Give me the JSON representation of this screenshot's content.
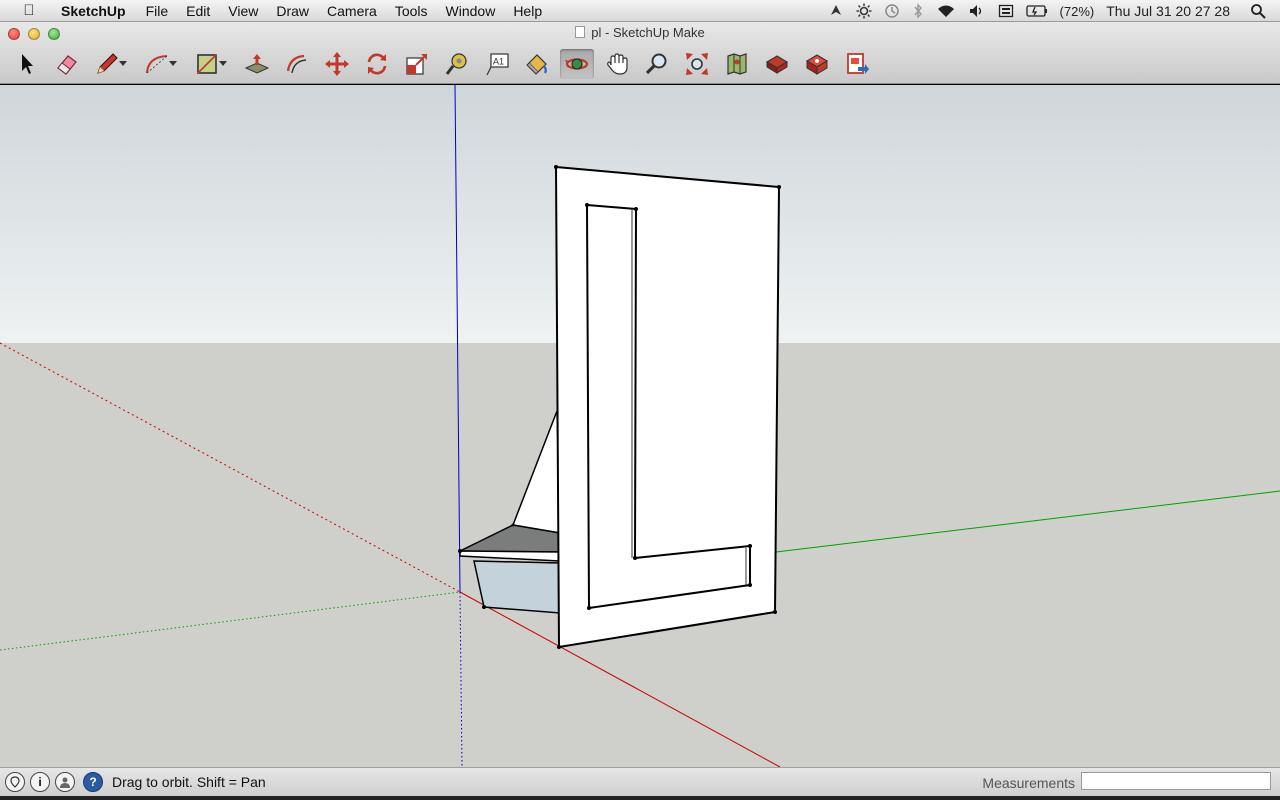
{
  "menubar": {
    "app_name": "SketchUp",
    "items": [
      "File",
      "Edit",
      "View",
      "Draw",
      "Camera",
      "Tools",
      "Window",
      "Help"
    ],
    "battery": "(72%)",
    "clock": "Thu Jul 31  20 27 28"
  },
  "window": {
    "title": "pl - SketchUp Make"
  },
  "toolbar": {
    "tools": [
      {
        "name": "select-tool",
        "icon": "arrow-cursor-icon"
      },
      {
        "name": "eraser-tool",
        "icon": "eraser-icon"
      },
      {
        "name": "line-tool",
        "icon": "pencil-icon"
      },
      {
        "name": "arc-tool",
        "icon": "arc-icon"
      },
      {
        "name": "rectangle-tool",
        "icon": "rectangle-icon"
      },
      {
        "name": "push-pull-tool",
        "icon": "push-pull-icon"
      },
      {
        "name": "offset-tool",
        "icon": "offset-icon"
      },
      {
        "name": "move-tool",
        "icon": "move-arrows-icon"
      },
      {
        "name": "rotate-tool",
        "icon": "rotate-icon"
      },
      {
        "name": "scale-tool",
        "icon": "scale-icon"
      },
      {
        "name": "tape-measure-tool",
        "icon": "tape-measure-icon"
      },
      {
        "name": "text-tool",
        "icon": "text-label-icon"
      },
      {
        "name": "paint-bucket-tool",
        "icon": "paint-bucket-icon"
      },
      {
        "name": "orbit-tool",
        "icon": "orbit-icon",
        "active": true
      },
      {
        "name": "pan-tool",
        "icon": "hand-icon"
      },
      {
        "name": "zoom-tool",
        "icon": "magnifier-icon"
      },
      {
        "name": "zoom-extents-tool",
        "icon": "zoom-extents-icon"
      },
      {
        "name": "previous-view-tool",
        "icon": "map-icon"
      },
      {
        "name": "warehouse-tool",
        "icon": "warehouse-icon"
      },
      {
        "name": "extension-warehouse-tool",
        "icon": "extension-box-icon"
      },
      {
        "name": "send-to-layout-tool",
        "icon": "send-to-layout-icon"
      }
    ],
    "text_tool_glyph": "A1"
  },
  "statusbar": {
    "hint": "Drag to orbit.  Shift = Pan",
    "measurements_label": "Measurements",
    "measurements_value": "",
    "icons": [
      "geo-location-icon",
      "info-icon",
      "user-icon",
      "help-icon"
    ],
    "info_glyph": "i",
    "help_glyph": "?"
  },
  "colors": {
    "sky": "#e9eef0",
    "ground": "#cfcfcb",
    "axis_red": "#cc0000",
    "axis_green": "#00a000",
    "axis_blue": "#0000cc"
  }
}
